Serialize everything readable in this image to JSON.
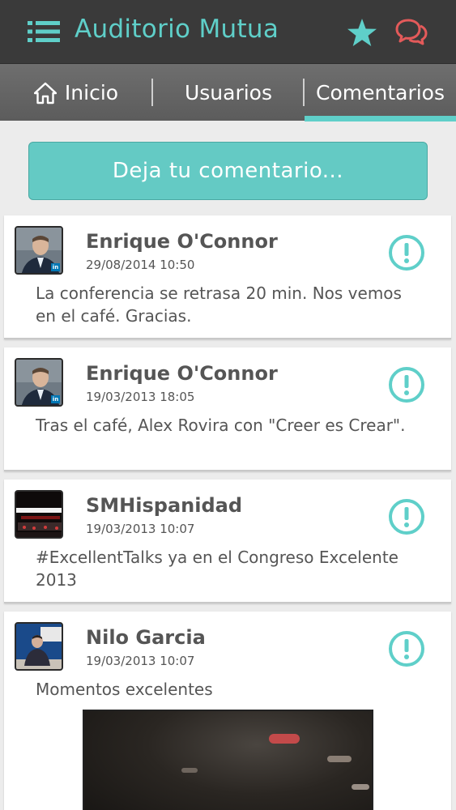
{
  "app": {
    "title": "Auditorio Mutua",
    "accent_color": "#5fcfc9",
    "danger_color": "#e35a5a"
  },
  "header": {
    "menu_icon": "hamburger-icon",
    "favorite_icon": "star-icon",
    "chat_icon": "chat-bubbles-icon"
  },
  "tabs": [
    {
      "label": "Inicio",
      "icon": "home-icon",
      "active": false
    },
    {
      "label": "Usuarios",
      "active": false
    },
    {
      "label": "Comentarios",
      "active": true
    }
  ],
  "actions": {
    "leave_comment_label": "Deja tu comentario..."
  },
  "comments": [
    {
      "author": "Enrique O'Connor",
      "date": "29/08/2014 10:50",
      "text": "La conferencia se retrasa 20 min. Nos vemos en el café. Gracias.",
      "avatar": "avatar-linkedin"
    },
    {
      "author": "Enrique O'Connor",
      "date": "19/03/2013 18:05",
      "text": "Tras el café, Alex Rovira con \"Creer es Crear\".",
      "avatar": "avatar-linkedin"
    },
    {
      "author": "SMHispanidad",
      "date": "19/03/2013 10:07",
      "text": "#ExcellentTalks ya en el Congreso Excelente 2013",
      "avatar": "avatar-stage"
    },
    {
      "author": "Nilo Garcia",
      "date": "19/03/2013 10:07",
      "text": "Momentos excelentes",
      "avatar": "avatar-tv",
      "has_image": true
    }
  ]
}
